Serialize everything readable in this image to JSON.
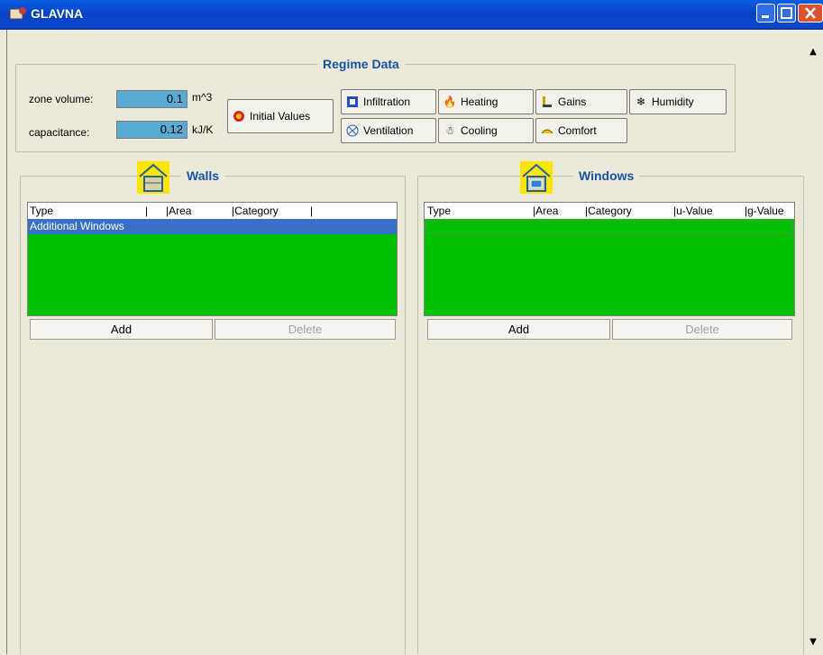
{
  "window": {
    "title": "GLAVNA"
  },
  "regime": {
    "legend": "Regime Data",
    "zone_volume": {
      "label": "zone volume:",
      "value": "0.1",
      "unit": "m^3"
    },
    "capacitance": {
      "label": "capacitance:",
      "value": "0.12",
      "unit": "kJ/K"
    },
    "initial_values": "Initial Values",
    "buttons": {
      "infiltration": "Infiltration",
      "heating": "Heating",
      "gains": "Gains",
      "humidity": "Humidity",
      "ventilation": "Ventilation",
      "cooling": "Cooling",
      "comfort": "Comfort"
    }
  },
  "walls": {
    "legend": "Walls",
    "columns": [
      "Type",
      "|",
      "|Area",
      "|Category",
      "|"
    ],
    "rows": [
      {
        "type": "Additional Windows"
      }
    ],
    "add": "Add",
    "delete": "Delete"
  },
  "windows": {
    "legend": "Windows",
    "columns": [
      "Type",
      "|Area",
      "|Category",
      "|u-Value",
      "|g-Value"
    ],
    "add": "Add",
    "delete": "Delete"
  },
  "colors": {
    "grid": "#00C000",
    "field": "#5AAAD6",
    "accent": "#1553A8"
  }
}
